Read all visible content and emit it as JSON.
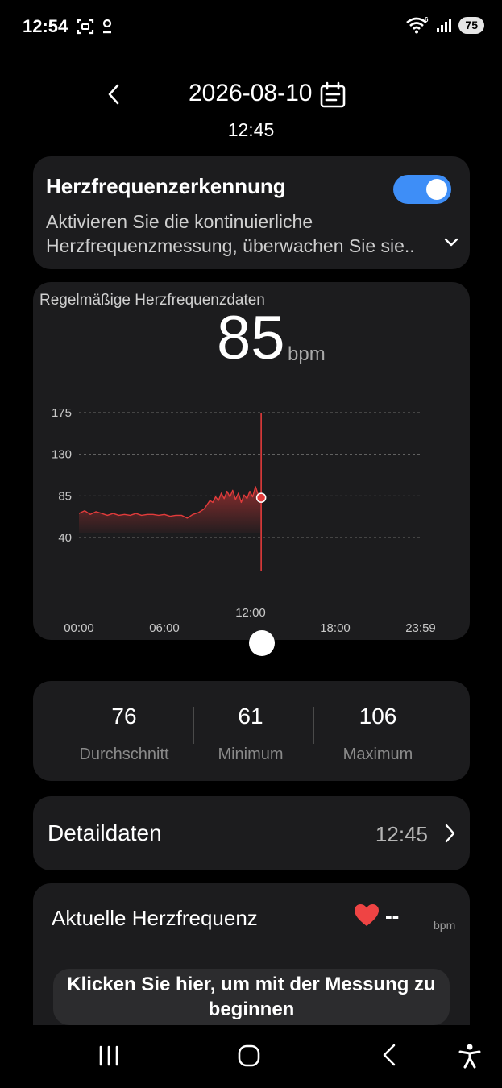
{
  "status_bar": {
    "time": "12:54",
    "battery": "75",
    "signal_label": "6"
  },
  "header": {
    "date": "2026-08-10",
    "time": "12:45"
  },
  "detection_card": {
    "title": "Herzfrequenzerkennung",
    "description_line1": "Aktivieren Sie die kontinuierliche",
    "description_line2": "Herzfrequenzmessung, überwachen Sie sie..",
    "toggle_on": true,
    "toggle_color": "#3e8ef7"
  },
  "chart_card": {
    "label": "Regelmäßige Herzfrequenzdaten",
    "current_value": "85",
    "unit": "bpm",
    "slider_time": "12:00"
  },
  "chart_data": {
    "type": "area",
    "y_ticks": [
      "175",
      "130",
      "85",
      "40"
    ],
    "y_tick_values": [
      175,
      130,
      85,
      40
    ],
    "x_ticks": [
      "00:00",
      "06:00",
      "18:00",
      "23:59"
    ],
    "x_tick_hours": [
      0,
      6,
      18,
      24
    ],
    "ylim": [
      0,
      200
    ],
    "xlim": [
      0,
      24
    ],
    "grid": true,
    "line_color": "#e23b3b",
    "selected": {
      "x": 12.8,
      "y": 83
    },
    "x": [
      0.0,
      0.4,
      0.8,
      1.2,
      1.6,
      2.0,
      2.4,
      2.8,
      3.2,
      3.6,
      4.0,
      4.4,
      4.8,
      5.2,
      5.6,
      6.0,
      6.4,
      6.8,
      7.2,
      7.6,
      8.0,
      8.4,
      8.8,
      9.2,
      9.4,
      9.6,
      9.8,
      10.0,
      10.2,
      10.4,
      10.6,
      10.8,
      11.0,
      11.2,
      11.4,
      11.6,
      11.8,
      12.0,
      12.2,
      12.4,
      12.6,
      12.8
    ],
    "y": [
      66,
      69,
      65,
      68,
      66,
      64,
      66,
      64,
      65,
      64,
      66,
      64,
      65,
      65,
      64,
      65,
      63,
      64,
      64,
      61,
      65,
      67,
      71,
      80,
      78,
      84,
      80,
      88,
      82,
      90,
      84,
      91,
      81,
      88,
      78,
      86,
      82,
      90,
      84,
      95,
      86,
      83
    ]
  },
  "stats": {
    "average": {
      "value": "76",
      "label": "Durchschnitt"
    },
    "minimum": {
      "value": "61",
      "label": "Minimum"
    },
    "maximum": {
      "value": "106",
      "label": "Maximum"
    }
  },
  "detail_row": {
    "title": "Detaildaten",
    "time": "12:45"
  },
  "current_hr": {
    "title": "Aktuelle Herzfrequenz",
    "value": "--",
    "unit": "bpm",
    "button_label": "Klicken Sie hier, um mit der Messung zu beginnen"
  },
  "icons": [
    "back-arrow-icon",
    "calendar-icon",
    "chevron-down-icon",
    "chevron-right-icon",
    "heart-icon",
    "recents-icon",
    "home-icon",
    "nav-back-icon",
    "accessibility-icon",
    "wifi-icon",
    "signal-icon",
    "screenshot-icon",
    "user-status-icon"
  ]
}
